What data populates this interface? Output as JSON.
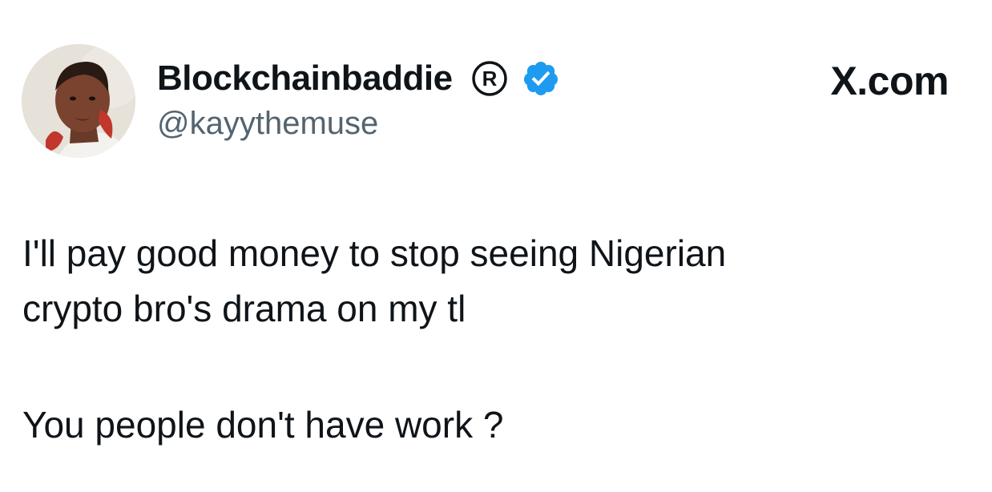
{
  "author": {
    "display_name": "Blockchainbaddie",
    "handle": "@kayythemuse",
    "registered_symbol": "R",
    "avatar_icon": "profile-photo-avatar",
    "verified_icon": "verified-badge-icon",
    "verified_color": "#1d9bf0"
  },
  "platform": {
    "label": "X.com"
  },
  "tweet": {
    "lines": [
      "I'll pay good money to stop seeing Nigerian",
      "crypto bro's drama on my tl",
      "You people don't have work ?"
    ]
  },
  "colors": {
    "text": "#0f1419",
    "secondary_text": "#536471",
    "background": "#ffffff"
  }
}
